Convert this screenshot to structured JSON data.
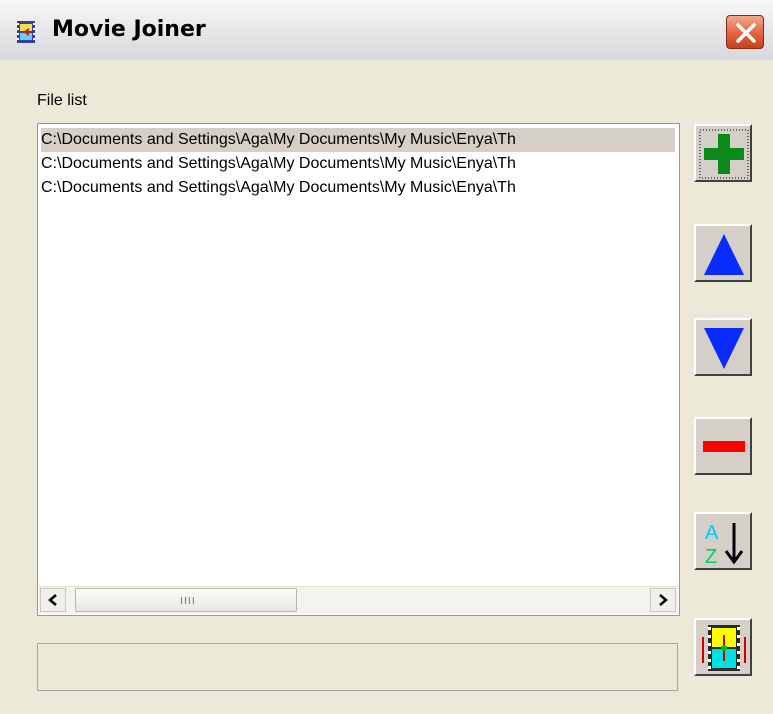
{
  "window": {
    "title": "Movie Joiner",
    "app_icon": "film-strip-icon",
    "close_icon": "close-icon"
  },
  "file_list": {
    "label": "File list",
    "items": [
      "C:\\Documents and Settings\\Aga\\My Documents\\My Music\\Enya\\Th",
      "C:\\Documents and Settings\\Aga\\My Documents\\My Music\\Enya\\Th",
      "C:\\Documents and Settings\\Aga\\My Documents\\My Music\\Enya\\Th"
    ],
    "selected_index": 0,
    "scrollbar": {
      "left_icon": "chevron-left-icon",
      "right_icon": "chevron-right-icon",
      "thumb_grip": "IIII"
    }
  },
  "status_text": "",
  "toolbar": {
    "buttons": [
      {
        "name": "add-file-button",
        "icon": "plus-icon",
        "color": "#0a8a1a"
      },
      {
        "name": "move-up-button",
        "icon": "arrow-up-icon",
        "color": "#0a2cff"
      },
      {
        "name": "move-down-button",
        "icon": "arrow-down-icon",
        "color": "#0a2cff"
      },
      {
        "name": "remove-file-button",
        "icon": "minus-icon",
        "color": "#ff0000"
      },
      {
        "name": "sort-button",
        "icon": "sort-az-icon",
        "color": "#00c8c8"
      },
      {
        "name": "join-button",
        "icon": "join-movies-icon",
        "color": "#ffff00"
      }
    ]
  },
  "colors": {
    "window_bg": "#ece9d8",
    "selection": "#d4d0c8",
    "close_button": "#e0653f"
  }
}
